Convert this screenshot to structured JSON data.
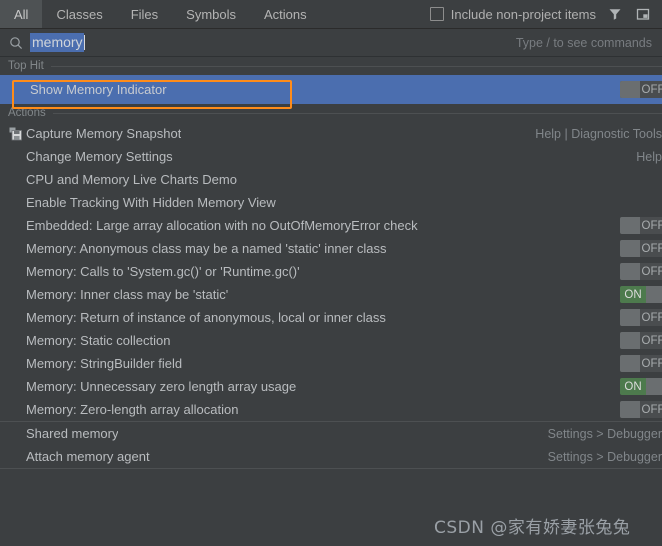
{
  "window": {
    "app": "search-everywhere-popup",
    "background_color": "#3c3f41",
    "accent_selection_color": "#4b6eaf",
    "annotation_color": "#ff8c1a",
    "toggle_on_color": "#4d7a4d",
    "toggle_off_color": "#4a4d4f"
  },
  "tabs": [
    {
      "label": "All",
      "active": true
    },
    {
      "label": "Classes",
      "active": false
    },
    {
      "label": "Files",
      "active": false
    },
    {
      "label": "Symbols",
      "active": false
    },
    {
      "label": "Actions",
      "active": false
    }
  ],
  "toolbar": {
    "include_non_project_label": "Include non-project items",
    "include_non_project_checked": false,
    "filter_icon": "filter-icon",
    "window_icon": "open-in-window-icon"
  },
  "search": {
    "icon": "search-icon",
    "value": "memory",
    "selected": true,
    "hint": "Type / to see commands"
  },
  "sections": {
    "top_hit": "Top Hit",
    "actions": "Actions"
  },
  "top_hit": {
    "label": "Show Memory Indicator",
    "toggle": "OFF",
    "toggle_state": "off",
    "selected": true,
    "annotated": true
  },
  "actions": [
    {
      "label": "Capture Memory Snapshot",
      "icon": "memory-snapshot-icon",
      "secondary": "Help | Diagnostic Tools",
      "toggle": null
    },
    {
      "label": "Change Memory Settings",
      "icon": null,
      "secondary": "Help",
      "toggle": null
    },
    {
      "label": "CPU and Memory Live Charts Demo",
      "icon": null,
      "secondary": "",
      "toggle": null
    },
    {
      "label": "Enable Tracking With Hidden Memory View",
      "icon": null,
      "secondary": "",
      "toggle": null
    },
    {
      "label": "Embedded: Large array allocation with no OutOfMemoryError check",
      "icon": null,
      "secondary": "",
      "toggle": "OFF"
    },
    {
      "label": "Memory: Anonymous class may be a named 'static' inner class",
      "icon": null,
      "secondary": "",
      "toggle": "OFF"
    },
    {
      "label": "Memory: Calls to 'System.gc()' or 'Runtime.gc()'",
      "icon": null,
      "secondary": "",
      "toggle": "OFF"
    },
    {
      "label": "Memory: Inner class may be 'static'",
      "icon": null,
      "secondary": "",
      "toggle": "ON"
    },
    {
      "label": "Memory: Return of instance of anonymous, local or inner class",
      "icon": null,
      "secondary": "",
      "toggle": "OFF"
    },
    {
      "label": "Memory: Static collection",
      "icon": null,
      "secondary": "",
      "toggle": "OFF"
    },
    {
      "label": "Memory: StringBuilder field",
      "icon": null,
      "secondary": "",
      "toggle": "OFF"
    },
    {
      "label": "Memory: Unnecessary zero length array usage",
      "icon": null,
      "secondary": "",
      "toggle": "ON"
    },
    {
      "label": "Memory: Zero-length array allocation",
      "icon": null,
      "secondary": "",
      "toggle": "OFF"
    },
    {
      "label": "Shared memory",
      "icon": null,
      "secondary": "Settings > Debugger",
      "toggle": null
    },
    {
      "label": "Attach memory agent",
      "icon": null,
      "secondary": "Settings > Debugger",
      "toggle": null
    }
  ],
  "watermark": {
    "text": "CSDN @家有娇妻张兔兔"
  }
}
